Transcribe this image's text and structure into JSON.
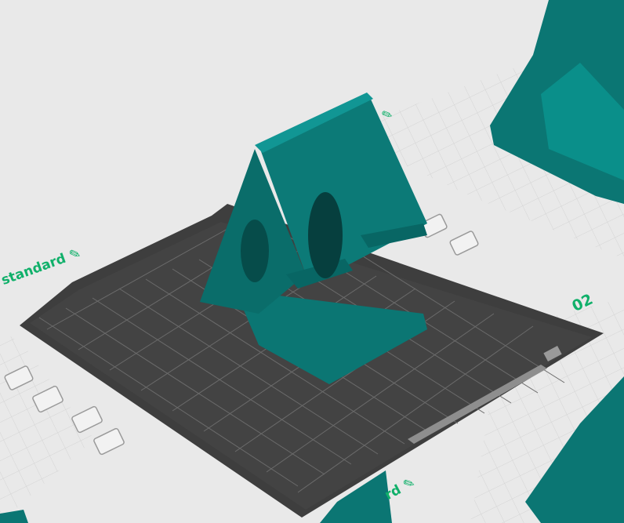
{
  "plates": {
    "main": {
      "name": "standard",
      "edit_icon": "pencil-edit-icon"
    },
    "right": {
      "number": "02"
    },
    "bottom": {
      "name_fragment": "rd",
      "edit_icon": "pencil-edit-icon"
    },
    "top_right": {
      "edit_icon": "pencil-edit-icon"
    }
  },
  "plate_buttons": [
    "pick-object-icon",
    "arrange-icon",
    "lock-plate-icon",
    "plate-settings-icon"
  ],
  "colors": {
    "background": "#e9e9e9",
    "bed_surface": "#3e3e3e",
    "bed_grid": "#6a6a6a",
    "model_teal": "#0b7673",
    "model_teal_dark": "#075856",
    "label_green": "#10b06a"
  }
}
